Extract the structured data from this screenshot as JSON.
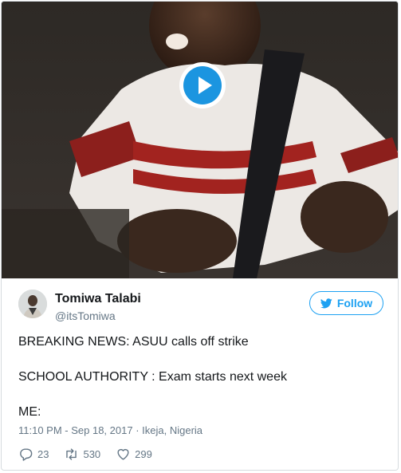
{
  "media": {
    "type": "video",
    "play_icon": "play-icon"
  },
  "author": {
    "name": "Tomiwa Talabi",
    "handle": "@itsTomiwa",
    "avatar_icon": "avatar"
  },
  "follow_button": {
    "label": "Follow",
    "icon": "twitter-bird-icon",
    "color": "#1da1f2"
  },
  "tweet": {
    "line1": "BREAKING NEWS: ASUU calls off strike",
    "line2": "SCHOOL AUTHORITY : Exam starts next week",
    "line3": "ME:"
  },
  "meta": {
    "timestamp": "11:10 PM - Sep 18, 2017",
    "separator": "·",
    "location": "Ikeja, Nigeria"
  },
  "actions": {
    "replies": "23",
    "retweets": "530",
    "likes": "299",
    "icon_color": "#657786"
  }
}
